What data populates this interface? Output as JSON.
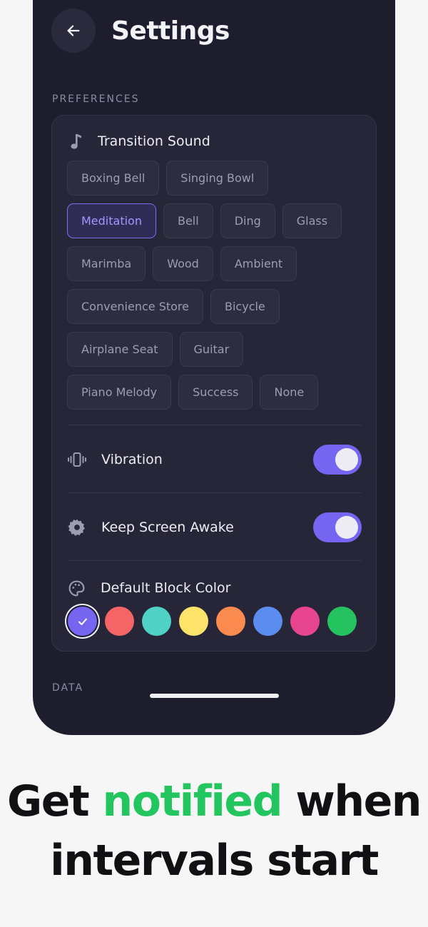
{
  "header": {
    "title": "Settings"
  },
  "sections": {
    "preferences": "PREFERENCES",
    "data": "DATA"
  },
  "transition_sound": {
    "label": "Transition Sound",
    "selected": "Meditation",
    "rows": [
      [
        "Boxing Bell",
        "Singing Bowl"
      ],
      [
        "Meditation",
        "Bell",
        "Ding",
        "Glass"
      ],
      [
        "Marimba",
        "Wood",
        "Ambient"
      ],
      [
        "Convenience Store",
        "Bicycle"
      ],
      [
        "Airplane Seat",
        "Guitar"
      ],
      [
        "Piano Melody",
        "Success",
        "None"
      ]
    ]
  },
  "vibration": {
    "label": "Vibration",
    "enabled": true
  },
  "keep_awake": {
    "label": "Keep Screen Awake",
    "enabled": true
  },
  "block_color": {
    "label": "Default Block Color",
    "selected_index": 0,
    "colors": [
      "#7565f0",
      "#f56565",
      "#4fd1c5",
      "#fde36a",
      "#fb8a4f",
      "#5b8def",
      "#e8458f",
      "#25c35f"
    ]
  },
  "tagline": {
    "line1_start": "Get ",
    "line1_accent": "notified",
    "line1_end": " when",
    "line2": "intervals start",
    "accent_color": "#22c55e"
  },
  "icons": {
    "back": "arrow-left-icon",
    "music": "music-note-icon",
    "vibration": "vibration-icon",
    "screen": "gear-icon",
    "palette": "palette-icon",
    "check": "check-icon"
  }
}
